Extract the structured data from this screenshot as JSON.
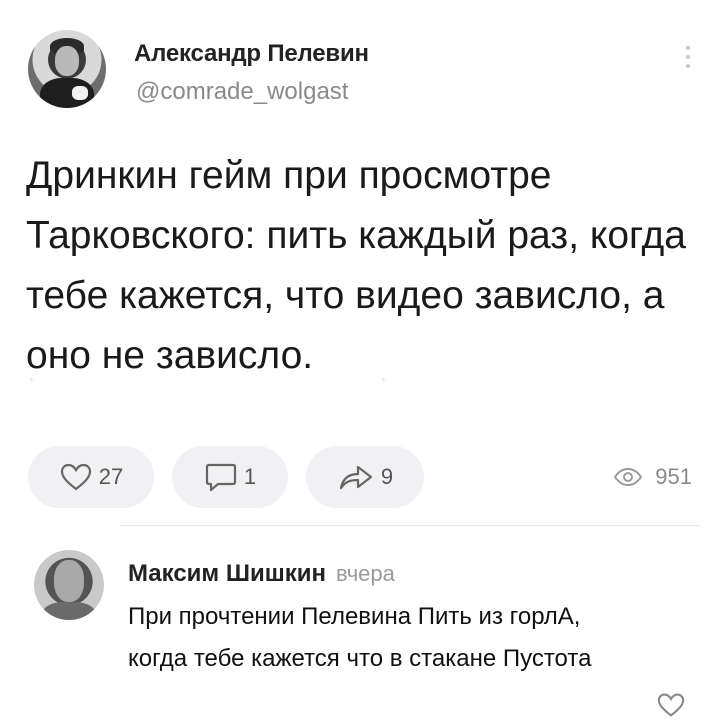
{
  "post": {
    "author_name": "Александр Пелевин",
    "author_handle": "@comrade_wolgast",
    "text": "Дринкин гейм при просмотре Тарковского: пить каждый раз, когда тебе кажется, что видео зависло, а оно не зависло.",
    "likes": "27",
    "comments": "1",
    "shares": "9",
    "views": "951"
  },
  "icons": {
    "more": "more-vertical-icon",
    "like": "heart-icon",
    "comment": "comment-bubble-icon",
    "share": "share-arrow-icon",
    "views": "eye-icon"
  },
  "comment": {
    "author_name": "Максим Шишкин",
    "time": "вчера",
    "text": "При прочтении Пелевина Пить из горлА, когда тебе кажется что в стакане Пустота"
  },
  "colors": {
    "pill_bg": "#f1f1f3",
    "muted_text": "#8a8a8a",
    "icon": "#555555"
  }
}
